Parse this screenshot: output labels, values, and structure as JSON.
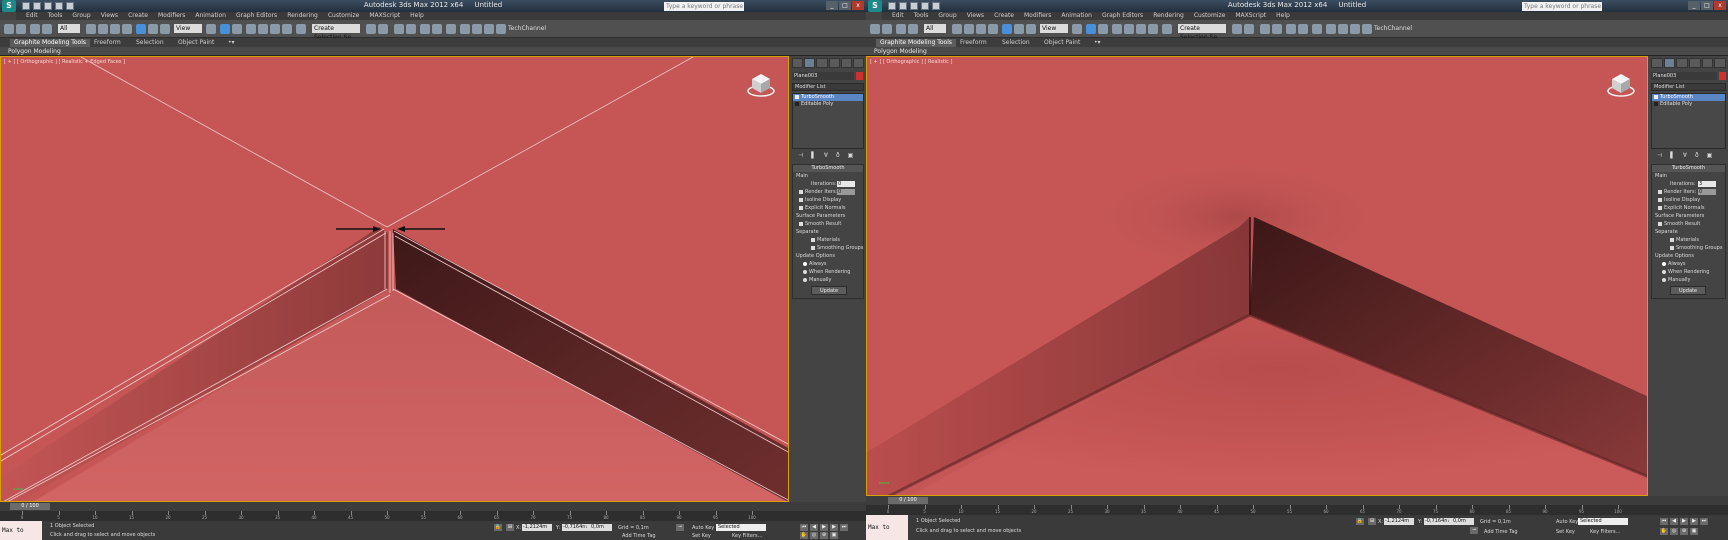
{
  "windows": [
    {
      "title": "Autodesk 3ds Max 2012 x64     Untitled",
      "search_placeholder": "Type a keyword or phrase",
      "menu": [
        "Edit",
        "Tools",
        "Group",
        "Views",
        "Create",
        "Modifiers",
        "Animation",
        "Graph Editors",
        "Rendering",
        "Customize",
        "MAXScript",
        "Help"
      ],
      "toolbar": {
        "filter_value": "All",
        "refcoord_value": "View",
        "selection_set_placeholder": "Create Selection Se",
        "channel_label": "TechChannel"
      },
      "ribbon_tabs": [
        "Graphite Modeling Tools",
        "Freeform",
        "Selection",
        "Object Paint"
      ],
      "ribbon_panel": "Polygon Modeling",
      "viewport_label": "[ + ] [ Orthographic ] [ Realistic + Edged Faces ]",
      "command_panel": {
        "object_name": "Plane003",
        "modifier_list": "Modifier List",
        "stack": [
          "TurboSmooth",
          "Editable Poly"
        ],
        "rollout_title": "TurboSmooth",
        "main_label": "Main",
        "iterations_label": "Iterations:",
        "iterations_value": "0",
        "render_iters_label": "Render Iters:",
        "render_iters_value": "0",
        "isoline_label": "Isoline Display",
        "explicit_normals_label": "Explicit Normals",
        "surface_params_label": "Surface Parameters",
        "smooth_result_label": "Smooth Result",
        "separate_label": "Separate",
        "materials_label": "Materials",
        "smoothing_groups_label": "Smoothing Groups",
        "update_options_label": "Update Options",
        "always_label": "Always",
        "when_rendering_label": "When Rendering",
        "manually_label": "Manually",
        "update_button": "Update"
      },
      "time_slider": "0 / 100",
      "ticks": [
        "0",
        "5",
        "10",
        "15",
        "20",
        "25",
        "30",
        "35",
        "40",
        "45",
        "50",
        "55",
        "60",
        "65",
        "70",
        "75",
        "80",
        "85",
        "90",
        "95",
        "100"
      ],
      "status": {
        "maxscript": "Max to Physc",
        "objects_selected": "1 Object Selected",
        "prompt": "Click and drag to select and move objects",
        "x_label": "X:",
        "x_value": "-1,2124m",
        "y_label": "Y:",
        "y_value": "-0,7164m",
        "z_label": "Z:",
        "z_value": "0,0m",
        "grid": "Grid = 0,1m",
        "add_time_tag": "Add Time Tag",
        "auto_key": "Auto Key",
        "selected": "Selected",
        "set_key": "Set Key",
        "key_filters": "Key Filters..."
      }
    },
    {
      "title": "Autodesk 3ds Max 2012 x64     Untitled",
      "search_placeholder": "Type a keyword or phrase",
      "menu": [
        "Edit",
        "Tools",
        "Group",
        "Views",
        "Create",
        "Modifiers",
        "Animation",
        "Graph Editors",
        "Rendering",
        "Customize",
        "MAXScript",
        "Help"
      ],
      "toolbar": {
        "filter_value": "All",
        "refcoord_value": "View",
        "selection_set_placeholder": "Create Selection Se",
        "channel_label": "TechChannel"
      },
      "ribbon_tabs": [
        "Graphite Modeling Tools",
        "Freeform",
        "Selection",
        "Object Paint"
      ],
      "ribbon_panel": "Polygon Modeling",
      "viewport_label": "[ + ] [ Orthographic ] [ Realistic ]",
      "command_panel": {
        "object_name": "Plane003",
        "modifier_list": "Modifier List",
        "stack": [
          "TurboSmooth",
          "Editable Poly"
        ],
        "rollout_title": "TurboSmooth",
        "main_label": "Main",
        "iterations_label": "Iterations:",
        "iterations_value": "3",
        "render_iters_label": "Render Iters:",
        "render_iters_value": "0",
        "isoline_label": "Isoline Display",
        "explicit_normals_label": "Explicit Normals",
        "surface_params_label": "Surface Parameters",
        "smooth_result_label": "Smooth Result",
        "separate_label": "Separate",
        "materials_label": "Materials",
        "smoothing_groups_label": "Smoothing Groups",
        "update_options_label": "Update Options",
        "always_label": "Always",
        "when_rendering_label": "When Rendering",
        "manually_label": "Manually",
        "update_button": "Update"
      },
      "time_slider": "0 / 100",
      "ticks": [
        "0",
        "5",
        "10",
        "15",
        "20",
        "25",
        "30",
        "35",
        "40",
        "45",
        "50",
        "55",
        "60",
        "65",
        "70",
        "75",
        "80",
        "85",
        "90",
        "95",
        "100"
      ],
      "status": {
        "maxscript": "Max to Physc",
        "objects_selected": "1 Object Selected",
        "prompt": "Click and drag to select and move objects",
        "x_label": "X:",
        "x_value": "-1,2124m",
        "y_label": "Y:",
        "y_value": "-0,7164m",
        "z_label": "Z:",
        "z_value": "0,0m",
        "grid": "Grid = 0,1m",
        "add_time_tag": "Add Time Tag",
        "auto_key": "Auto Key",
        "selected": "Selected",
        "set_key": "Set Key",
        "key_filters": "Key Filters..."
      }
    }
  ],
  "colors": {
    "viewport_bg": "#c55656",
    "selection_blue": "#5a86c6",
    "object_color": "#d03030"
  }
}
